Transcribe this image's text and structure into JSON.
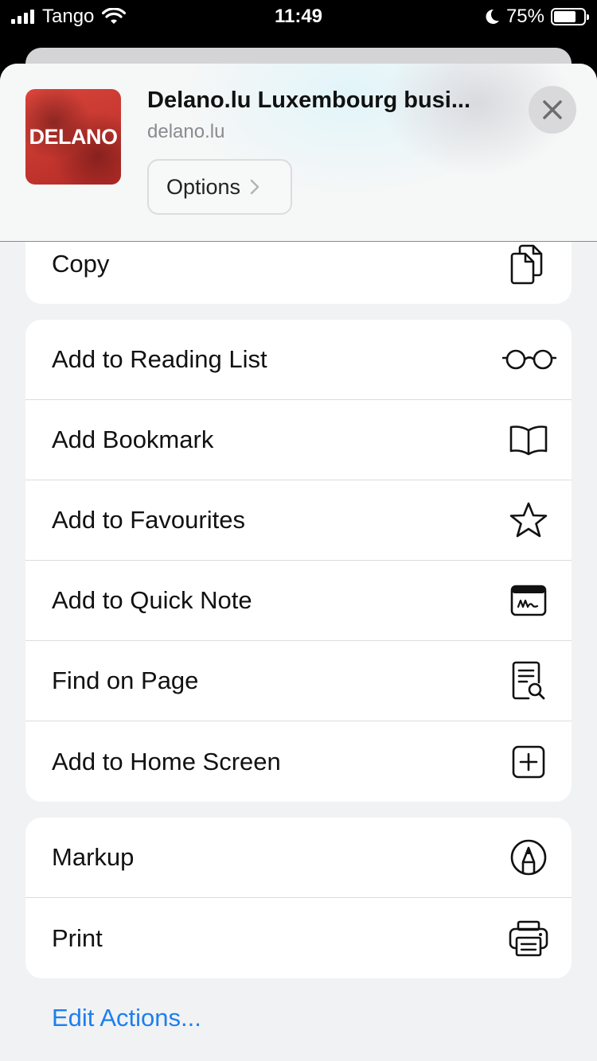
{
  "status_bar": {
    "carrier": "Tango",
    "time": "11:49",
    "battery_percent": "75%",
    "battery_level": 0.75
  },
  "header": {
    "thumbnail_text": "DELANO",
    "title": "Delano.lu Luxembourg busi...",
    "domain": "delano.lu",
    "options_label": "Options"
  },
  "groups": [
    {
      "items": [
        {
          "label": "Copy",
          "icon": "copy-icon"
        }
      ]
    },
    {
      "items": [
        {
          "label": "Add to Reading List",
          "icon": "glasses-icon"
        },
        {
          "label": "Add Bookmark",
          "icon": "book-icon"
        },
        {
          "label": "Add to Favourites",
          "icon": "star-icon"
        },
        {
          "label": "Add to Quick Note",
          "icon": "quick-note-icon"
        },
        {
          "label": "Find on Page",
          "icon": "find-document-icon"
        },
        {
          "label": "Add to Home Screen",
          "icon": "plus-square-icon"
        }
      ]
    },
    {
      "items": [
        {
          "label": "Markup",
          "icon": "markup-pen-icon"
        },
        {
          "label": "Print",
          "icon": "printer-icon"
        }
      ]
    }
  ],
  "edit_actions_label": "Edit Actions...",
  "colors": {
    "accent": "#1c7ff0",
    "thumbnail_red": "#c9332d",
    "sheet_background": "#f1f2f3"
  }
}
